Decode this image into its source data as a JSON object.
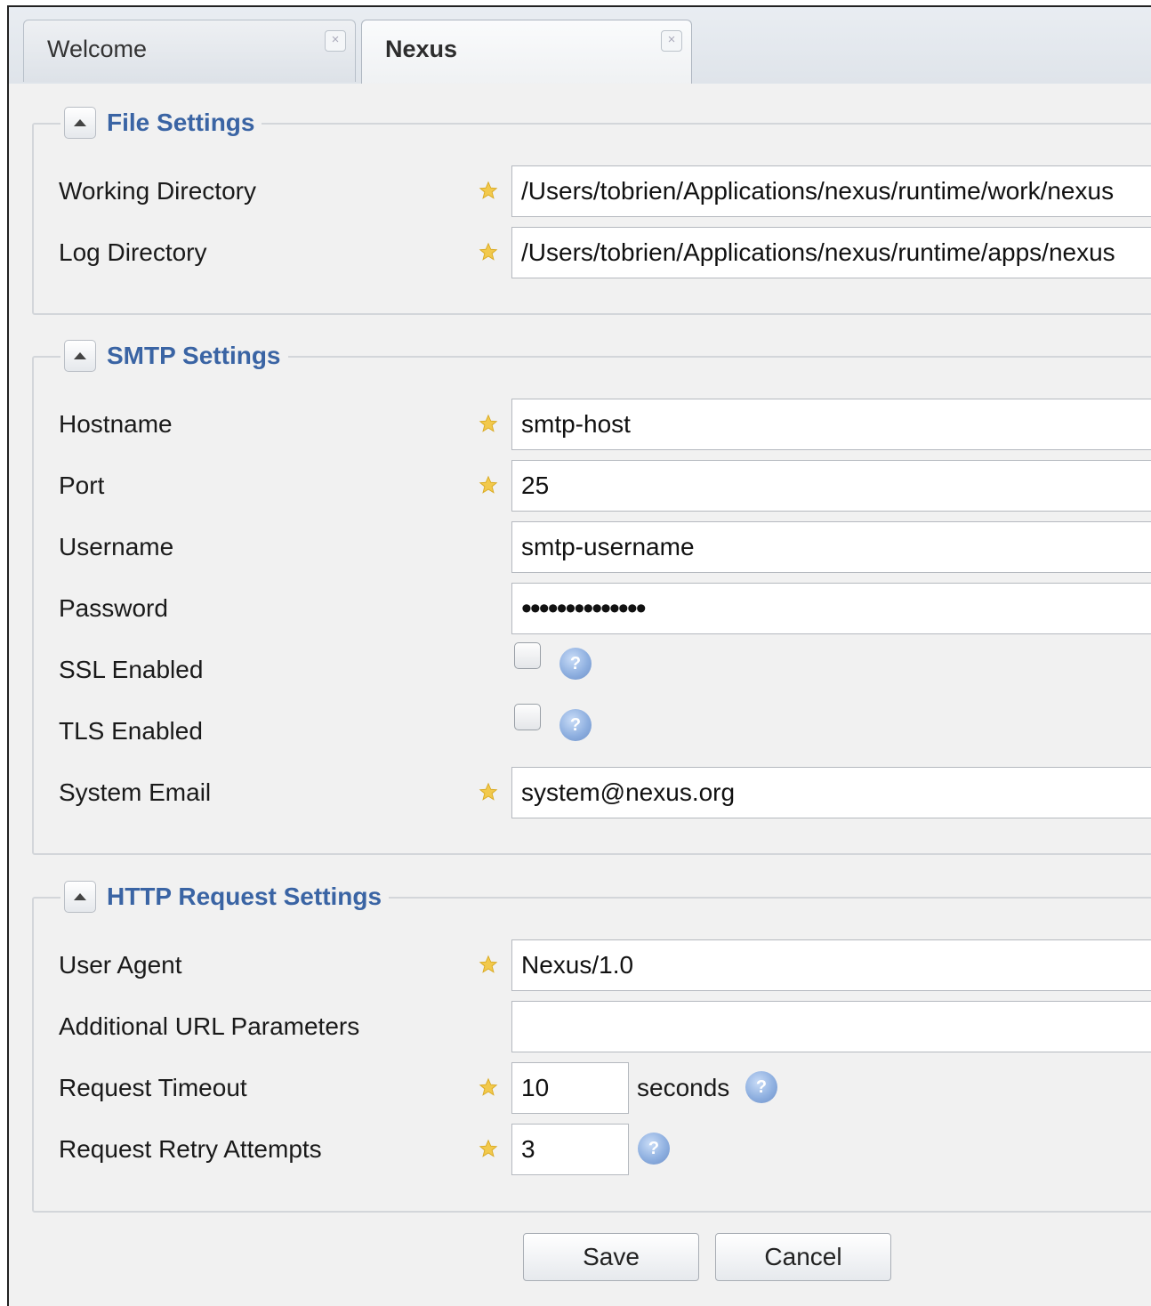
{
  "tabs": [
    {
      "label": "Welcome",
      "close_icon": "×"
    },
    {
      "label": "Nexus",
      "close_icon": "×"
    }
  ],
  "sections": {
    "file_settings": {
      "title": "File Settings",
      "fields": {
        "working_directory": {
          "label": "Working Directory",
          "value": "/Users/tobrien/Applications/nexus/runtime/work/nexus"
        },
        "log_directory": {
          "label": "Log Directory",
          "value": "/Users/tobrien/Applications/nexus/runtime/apps/nexus"
        }
      }
    },
    "smtp_settings": {
      "title": "SMTP Settings",
      "fields": {
        "hostname": {
          "label": "Hostname",
          "value": "smtp-host"
        },
        "port": {
          "label": "Port",
          "value": "25"
        },
        "username": {
          "label": "Username",
          "value": "smtp-username"
        },
        "password": {
          "label": "Password",
          "value": "••••••••••••••"
        },
        "ssl_enabled": {
          "label": "SSL Enabled",
          "checked": false
        },
        "tls_enabled": {
          "label": "TLS Enabled",
          "checked": false
        },
        "system_email": {
          "label": "System Email",
          "value": "system@nexus.org"
        }
      }
    },
    "http_request_settings": {
      "title": "HTTP Request Settings",
      "fields": {
        "user_agent": {
          "label": "User Agent",
          "value": "Nexus/1.0"
        },
        "additional_url_parameters": {
          "label": "Additional URL Parameters",
          "value": ""
        },
        "request_timeout": {
          "label": "Request Timeout",
          "value": "10",
          "unit": "seconds"
        },
        "request_retry_attempts": {
          "label": "Request Retry Attempts",
          "value": "3"
        }
      }
    }
  },
  "buttons": {
    "save": "Save",
    "cancel": "Cancel"
  },
  "icons": {
    "required": "star-icon",
    "help": "help-icon",
    "collapse": "chevron-up-icon"
  },
  "colors": {
    "section_title": "#3a64a4",
    "required_star": "#f2c94c",
    "help": "#8fb0e0"
  }
}
